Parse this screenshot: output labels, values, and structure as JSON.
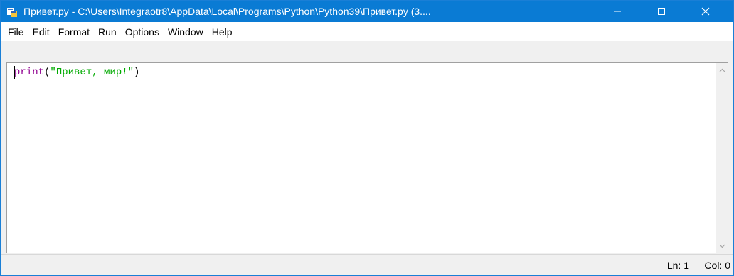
{
  "window": {
    "title": "Привет.py - C:\\Users\\Integraotr8\\AppData\\Local\\Programs\\Python\\Python39\\Привет.py (3....",
    "controls": {
      "minimize": "—",
      "maximize": "☐",
      "close": "✕"
    }
  },
  "menu": {
    "items": [
      {
        "label": "File"
      },
      {
        "label": "Edit"
      },
      {
        "label": "Format"
      },
      {
        "label": "Run"
      },
      {
        "label": "Options"
      },
      {
        "label": "Window"
      },
      {
        "label": "Help"
      }
    ]
  },
  "editor": {
    "code": {
      "keyword": "print",
      "open_paren": "(",
      "string": "\"Привет, мир!\"",
      "close_paren": ")"
    }
  },
  "status": {
    "line": "Ln: 1",
    "column": "Col: 0"
  },
  "colors": {
    "titlebar": "#0a7bd4",
    "keyword": "#900090",
    "string": "#00aa00"
  },
  "icons": {
    "app": "python-idle-icon",
    "scroll_up": "chevron-up-icon",
    "scroll_down": "chevron-down-icon"
  }
}
